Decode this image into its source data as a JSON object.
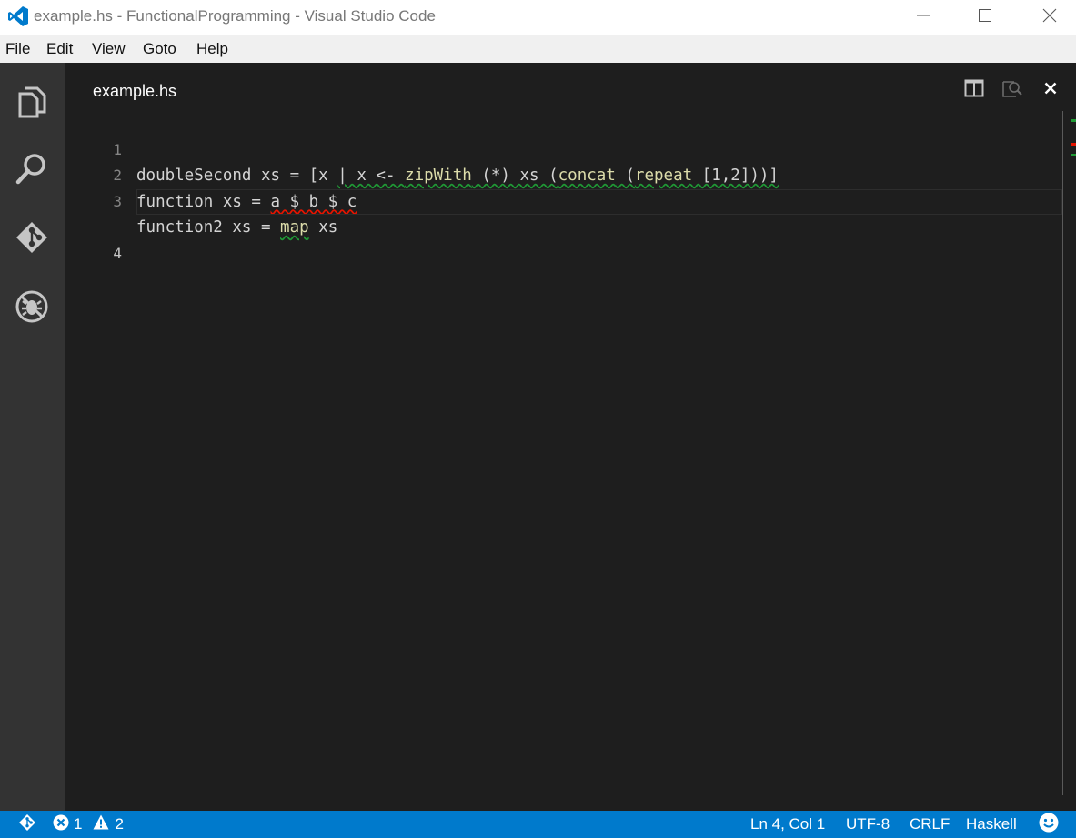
{
  "window": {
    "title": "example.hs - FunctionalProgramming - Visual Studio Code",
    "accent": "#007acc"
  },
  "titlebar": {
    "app_icon": "vscode-logo-icon",
    "controls": [
      "minimize-icon",
      "maximize-icon",
      "close-icon"
    ]
  },
  "menu": {
    "file": "File",
    "edit": "Edit",
    "view": "View",
    "goto": "Goto",
    "help": "Help"
  },
  "activity_bar": [
    "explorer-icon",
    "search-icon",
    "git-icon",
    "debug-icon"
  ],
  "editor": {
    "tab_title": "example.hs",
    "actions": [
      "split-editor-icon",
      "open-preview-icon",
      "close-editor-icon"
    ],
    "lines": [
      {
        "number": "1",
        "text": "doubleSecond xs = [x | x <- zipWith (*) xs (concat (repeat [1,2]))]"
      },
      {
        "number": "2",
        "text": "function xs = a $ b $ c"
      },
      {
        "number": "3",
        "text": "function2 xs = map xs"
      },
      {
        "number": "4",
        "text": ""
      }
    ],
    "tokens": {
      "l1_a": "doubleSecond xs = [x ",
      "l1_b": "| x <- ",
      "l1_c": "zipWith",
      "l1_d": " (*) xs (",
      "l1_e": "concat",
      "l1_f": " (",
      "l1_g": "repeat",
      "l1_h": " [1,2]))]",
      "l2_a": "function xs = ",
      "l2_b": "a $ b $ c",
      "l3_a": "function2 xs = ",
      "l3_b": "map",
      "l3_c": " xs"
    }
  },
  "status": {
    "errors": "1",
    "warnings": "2",
    "position": "Ln 4, Col 1",
    "encoding": "UTF-8",
    "eol": "CRLF",
    "language": "Haskell",
    "feedback_icon": "smiley-icon"
  },
  "colors": {
    "error": "#e51400",
    "warning": "#1f9a35",
    "function": "#dcdcaa",
    "statusbar": "#007acc"
  }
}
